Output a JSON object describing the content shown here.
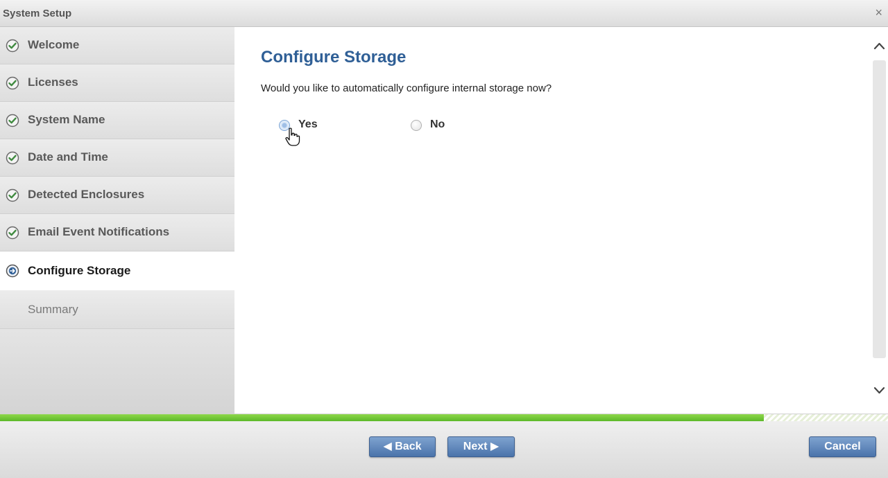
{
  "window": {
    "title": "System Setup",
    "close_glyph": "×"
  },
  "sidebar": {
    "items": [
      {
        "label": "Welcome",
        "state": "complete",
        "icon": "check-circle-icon"
      },
      {
        "label": "Licenses",
        "state": "complete",
        "icon": "check-circle-icon"
      },
      {
        "label": "System Name",
        "state": "complete",
        "icon": "check-circle-icon"
      },
      {
        "label": "Date and Time",
        "state": "complete",
        "icon": "check-circle-icon"
      },
      {
        "label": "Detected Enclosures",
        "state": "complete",
        "icon": "check-circle-icon"
      },
      {
        "label": "Email Event Notifications",
        "state": "complete",
        "icon": "check-circle-icon"
      },
      {
        "label": "Configure Storage",
        "state": "current",
        "icon": "arrow-circle-icon"
      },
      {
        "label": "Summary",
        "state": "pending",
        "icon": ""
      }
    ]
  },
  "main": {
    "title": "Configure Storage",
    "question": "Would you like to automatically configure internal storage now?",
    "options": [
      {
        "label": "Yes",
        "selected": false
      },
      {
        "label": "No",
        "selected": false
      }
    ]
  },
  "progress": {
    "fraction": 0.86
  },
  "footer": {
    "back_label": "◀ Back",
    "next_label": "Next ▶",
    "cancel_label": "Cancel"
  },
  "colors": {
    "accent": "#2f5f96",
    "button": "#4a73aa",
    "progress": "#6cc832",
    "check": "#3f8a3f"
  }
}
